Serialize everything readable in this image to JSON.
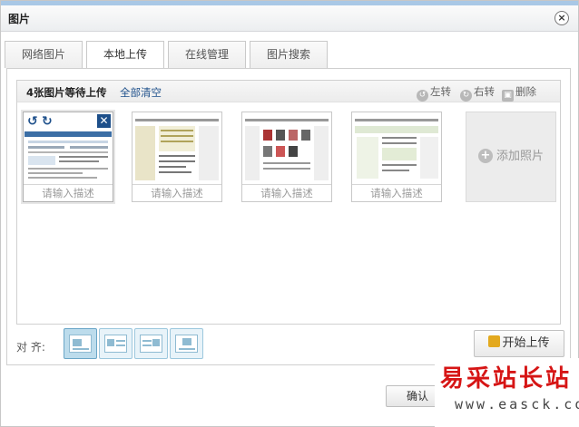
{
  "window": {
    "title": "图片"
  },
  "tabs": [
    {
      "label": "网络图片"
    },
    {
      "label": "本地上传"
    },
    {
      "label": "在线管理"
    },
    {
      "label": "图片搜索"
    }
  ],
  "upload": {
    "status": "4张图片等待上传",
    "clear_all": "全部清空",
    "tools": {
      "rotate_left": "左转",
      "rotate_right": "右转",
      "delete": "删除"
    },
    "thumbnails": [
      {
        "placeholder": "请输入描述",
        "selected": true
      },
      {
        "placeholder": "请输入描述",
        "selected": false
      },
      {
        "placeholder": "请输入描述",
        "selected": false
      },
      {
        "placeholder": "请输入描述",
        "selected": false
      }
    ],
    "add_photo": "添加照片"
  },
  "align": {
    "label": "对 齐:",
    "options": [
      "default",
      "left",
      "right",
      "center"
    ],
    "active": "default"
  },
  "start_upload": "开始上传",
  "confirm": "确认",
  "watermark": {
    "cn": "易采站长站",
    "url": "www.easck.com"
  },
  "colors": {
    "accent": "#1d4f8a",
    "align_active": "#bcdcec",
    "watermark_red": "#d61515"
  }
}
